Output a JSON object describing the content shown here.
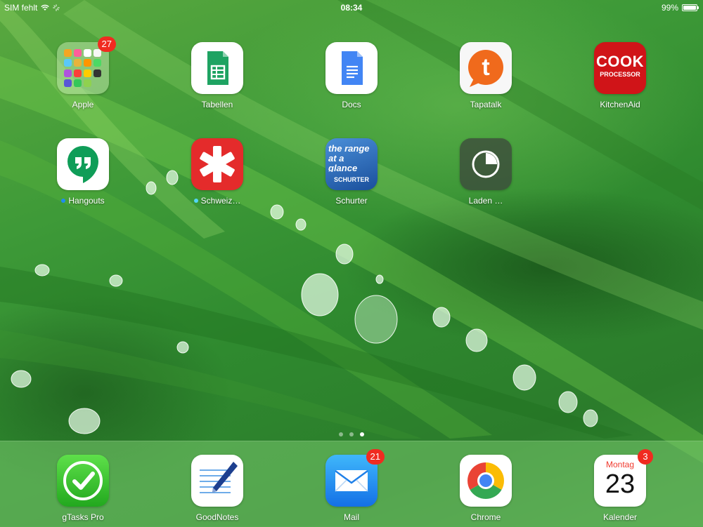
{
  "status_bar": {
    "carrier": "SIM fehlt",
    "time": "08:34",
    "battery_text": "99%",
    "battery_level": 0.99
  },
  "home_apps": [
    {
      "label": "Apple",
      "badge": "27",
      "icon": "folder-icon"
    },
    {
      "label": "Tabellen",
      "icon": "sheets-icon"
    },
    {
      "label": "Docs",
      "icon": "docs-icon"
    },
    {
      "label": "Tapatalk",
      "icon": "tapatalk-icon"
    },
    {
      "label": "KitchenAid",
      "icon": "cook-processor-icon",
      "logo_text_1": "COOK",
      "logo_text_2": "PROCESSOR"
    },
    {
      "label": "Hangouts",
      "icon": "hangouts-icon",
      "dot_color": "#1f8cf0"
    },
    {
      "label": "Schweiz…",
      "icon": "star-icon",
      "dot_color": "#53d6f5"
    },
    {
      "label": "Schurter",
      "icon": "schurter-icon",
      "logo_text_1": "the range at a glance",
      "logo_text_2": "SCHURTER"
    },
    {
      "label": "Laden …",
      "icon": "loading-icon"
    }
  ],
  "dock_apps": [
    {
      "label": "gTasks Pro",
      "icon": "checkmark-icon"
    },
    {
      "label": "GoodNotes",
      "icon": "notes-pen-icon"
    },
    {
      "label": "Mail",
      "badge": "21",
      "icon": "mail-icon"
    },
    {
      "label": "Chrome",
      "icon": "chrome-icon"
    },
    {
      "label": "Kalender",
      "badge": "3",
      "icon": "calendar-icon",
      "weekday": "Montag",
      "day": "23"
    }
  ],
  "colors": {
    "badge": "#f02b20",
    "dock": "#78c86e"
  }
}
